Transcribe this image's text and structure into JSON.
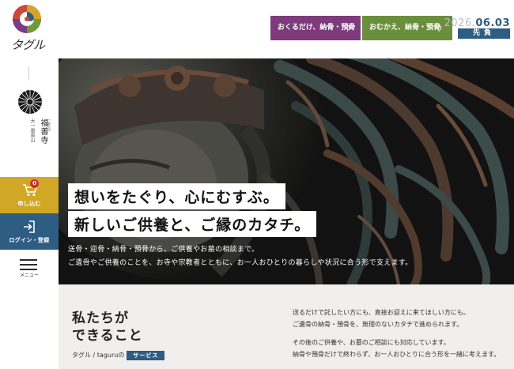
{
  "brand": {
    "logo_text": "タグル"
  },
  "temple": {
    "name": "福善寺",
    "mountain": "大一風南山",
    "sect": "一般社団"
  },
  "header": {
    "send_button": "おくるだけ、納骨・預骨",
    "pickup_button": "おむかえ、納骨・預骨",
    "date_year": "2026.",
    "date_md": "06.03",
    "fortune": "先負"
  },
  "sidebar": {
    "apply_label": "申し込む",
    "cart_count": "0",
    "login_label": "ログイン・登録",
    "menu_label": "メニュー"
  },
  "hero": {
    "headline_1": "想いをたぐり、心にむすぶ。",
    "headline_2": "新しいご供養と、ご縁のカタチ。",
    "sub_1": "送骨・迎骨・納骨・預骨から、ご供養やお墓の相談まで。",
    "sub_2": "ご遺骨やご供養のことを、お寺や宗教者とともに、お一人おひとりの暮らしや状況に合う形で支えます。"
  },
  "intro": {
    "title_line1": "私たちが",
    "title_line2": "できること",
    "tag_prefix": "タグル / taguruの",
    "tag_badge": "サービス",
    "para_1": "送るだけで託したい方にも、直接お迎えに来てほしい方にも。",
    "para_2": "ご遺骨の納骨・預骨を、無理のないカタチで進められます。",
    "para_3": "その後のご供養や、お墓のご相談にも対応しています。",
    "para_4": "納骨や預骨だけで終わらず、お一人おひとりに合う形を一緒に考えます。"
  },
  "icons": {
    "cart": "cart-icon",
    "login": "login-icon",
    "menu": "hamburger-icon",
    "chevron": "chevron-right-icon"
  },
  "colors": {
    "purple": "#7d3a7c",
    "green": "#6b8e3c",
    "navy": "#2d5d82",
    "gold": "#d1a825",
    "lower_bg": "#f0efed"
  }
}
